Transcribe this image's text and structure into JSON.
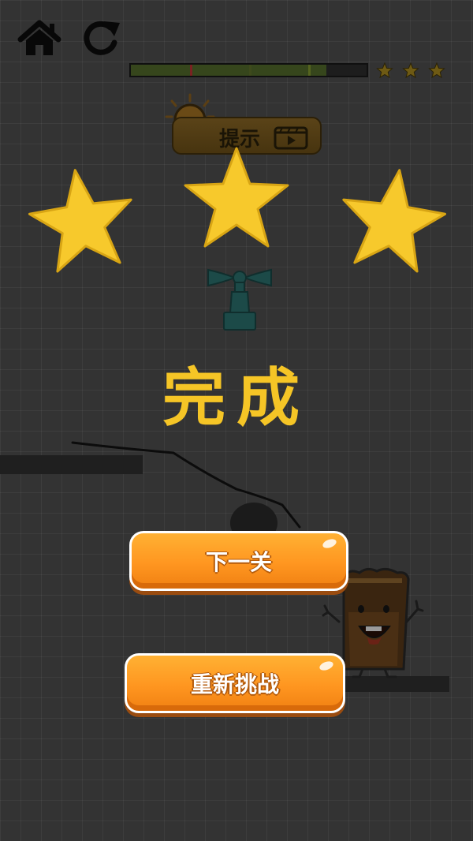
{
  "top_bar": {
    "home_icon": "home-icon",
    "restart_icon": "restart-icon",
    "progress_fraction": 0.83,
    "progress_color": "#36461c",
    "segment_colors": [
      "#7a2222",
      "#3e4a1c",
      "#55641f"
    ],
    "mini_stars_count": 3,
    "mini_star_color": "#6e5a14"
  },
  "hint": {
    "label": "提示",
    "bulb_icon": "lightbulb-icon",
    "video_icon": "video-play-icon"
  },
  "result": {
    "stars_earned": 3,
    "star_color": "#f7c92c",
    "title": "完成"
  },
  "scene": {
    "faucet_icon": "water-tap-icon",
    "mascot": "smiling-cup-character"
  },
  "buttons": {
    "next_level": "下一关",
    "retry": "重新挑战"
  }
}
